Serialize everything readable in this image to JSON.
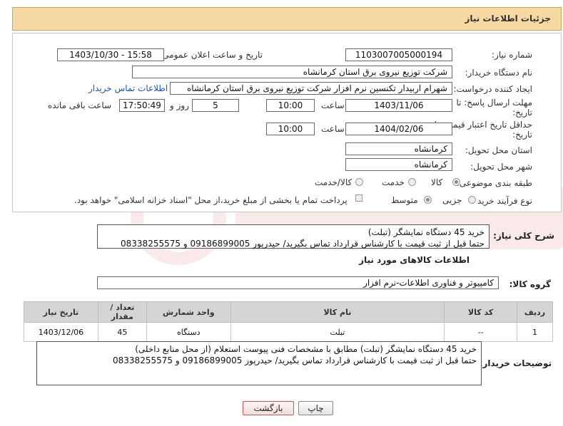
{
  "header": {
    "title": "جزئیات اطلاعات نیاز"
  },
  "form": {
    "need_number_label": "شماره نیاز:",
    "need_number": "1103007005000194",
    "announce_label": "تاریخ و ساعت اعلان عمومی:",
    "announce_value": "1403/10/30 - 15:58",
    "buyer_org_label": "نام دستگاه خریدار:",
    "buyer_org": "شرکت توزیع نیروی برق استان کرمانشاه",
    "requester_label": "ایجاد کننده درخواست:",
    "requester": "شهرام اربیدار تکنسین نرم افزار شرکت توزیع نیروی برق استان کرمانشاه",
    "buyer_contact_link": "اطلاعات تماس خریدار",
    "deadline_label_1": "مهلت ارسال پاسخ: تا",
    "deadline_label_2": "تاریخ:",
    "deadline_date": "1403/11/06",
    "time_label": "ساعت",
    "deadline_time": "10:00",
    "days_value": "5",
    "days_label": "روز و",
    "remaining_time": "17:50:49",
    "remaining_label": "ساعت باقی مانده",
    "validity_label_1": "حداقل تاریخ اعتبار قیمت: تا",
    "validity_label_2": "تاریخ:",
    "validity_date": "1404/02/06",
    "validity_time": "10:00",
    "province_label": "استان محل تحویل:",
    "province": "کرمانشاه",
    "city_label": "شهر محل تحویل:",
    "city": "کرمانشاه",
    "category_label": "طبقه بندی موضوعی:",
    "category_options": [
      "کالا",
      "خدمت",
      "کالا/خدمت"
    ],
    "category_selected": "کالا",
    "process_label": "نوع فرآیند خرید :",
    "process_options": [
      "جزیی",
      "متوسط"
    ],
    "payment_note": "پرداخت تمام یا بخشی از مبلغ خرید،از محل \"اسناد خزانه اسلامی\" خواهد بود."
  },
  "summary": {
    "label": "شرح کلی نیاز:",
    "lines": [
      "خرید 45 دستگاه نمایشگر (تبلت)",
      "حتما قبل از ثبت قیمت با کارشناس قرارداد تماس بگیرید/ حیدرپور 09186899005 و 08338255575"
    ]
  },
  "goods": {
    "section_title": "اطلاعات کالاهای مورد نیاز",
    "group_label": "گروه کالا:",
    "group_value": "کامپیوتر و فناوری اطلاعات-نرم افزار",
    "columns": [
      "ردیف",
      "کد کالا",
      "نام کالا",
      "واحد شمارش",
      "تعداد / مقدار",
      "تاریخ نیاز"
    ],
    "rows": [
      {
        "row": "1",
        "code": "--",
        "name": "تبلت",
        "unit": "دستگاه",
        "qty": "45",
        "date": "1403/12/06"
      }
    ]
  },
  "buyer_notes": {
    "label": "توضیحات خریدار:",
    "lines": [
      "خرید 45 دستگاه نمایشگر (تبلت) مطابق با مشخصات فنی پیوست استعلام (از محل منابع داخلی)",
      "حتما قبل از ثبت قیمت با کارشناس قرارداد تماس بگیرید/ حیدرپور 09186899005 و 08338255575"
    ]
  },
  "buttons": {
    "print": "چاپ",
    "back": "بازگشت"
  },
  "colors": {
    "header_bg": "#f6d9a3",
    "link": "#1a56b8",
    "table_head": "#d5d5d5",
    "back_border": "#d9534f"
  }
}
